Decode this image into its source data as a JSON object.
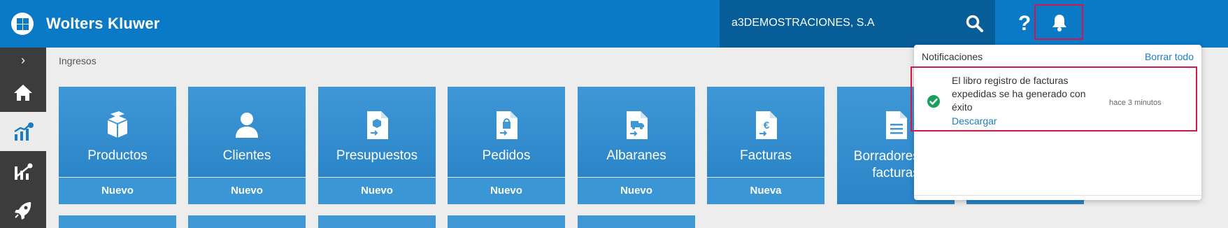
{
  "header": {
    "brand": "Wolters Kluwer",
    "company": "a3DEMOSTRACIONES, S.A",
    "help_label": "?",
    "icons": [
      "logo-icon",
      "search-icon",
      "help-icon",
      "bell-icon"
    ]
  },
  "sidebar": {
    "toggle_label": "›",
    "items": [
      {
        "icon": "home-icon"
      },
      {
        "icon": "sales-chart-icon"
      },
      {
        "icon": "analytics-icon"
      },
      {
        "icon": "rocket-icon"
      }
    ]
  },
  "breadcrumb": "Ingresos",
  "tiles": [
    {
      "label": "Productos",
      "action": "Nuevo",
      "icon": "box-icon"
    },
    {
      "label": "Clientes",
      "action": "Nuevo",
      "icon": "person-icon"
    },
    {
      "label": "Presupuestos",
      "action": "Nuevo",
      "icon": "budget-doc-icon"
    },
    {
      "label": "Pedidos",
      "action": "Nuevo",
      "icon": "order-doc-icon"
    },
    {
      "label": "Albaranes",
      "action": "Nuevo",
      "icon": "delivery-doc-icon"
    },
    {
      "label": "Facturas",
      "action": "Nueva",
      "icon": "invoice-doc-icon"
    },
    {
      "label_line1": "Borradores de",
      "label_line2": "facturas",
      "icon": "draft-doc-icon"
    }
  ],
  "notifications": {
    "title": "Notificaciones",
    "clear_label": "Borrar todo",
    "items": [
      {
        "message": "El libro registro de facturas expedidas se ha generado con éxito",
        "link": "Descargar",
        "time": "hace 3 minutos"
      }
    ]
  },
  "colors": {
    "header": "#0a7ac6",
    "company_box": "#075d97",
    "tile": "#3f97d6",
    "sidebar": "#3c3c3c",
    "highlight": "#d3174a",
    "success": "#1a9e5c",
    "link": "#1a7dc4"
  }
}
